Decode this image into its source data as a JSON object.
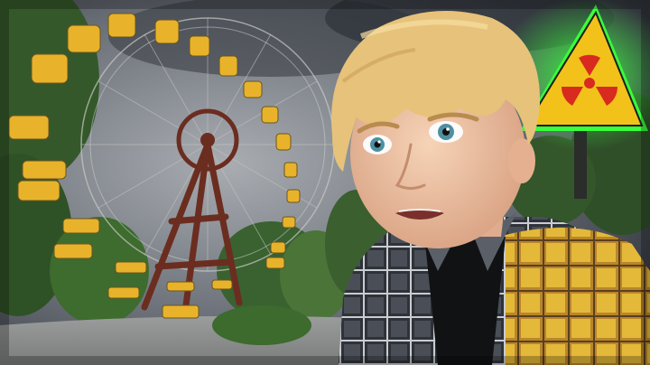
{
  "scene": {
    "kind": "video-thumbnail",
    "subjects": [
      "abandoned-ferris-wheel",
      "surprised-person",
      "radiation-warning-sign"
    ],
    "icons": [
      "radiation-icon"
    ]
  },
  "colors": {
    "sky_dark": "#2b2f36",
    "sky_mid": "#6f747c",
    "sky_light": "#a9adb2",
    "trees": "#3e6b2e",
    "gondola_yellow": "#e8b32a",
    "wheel_rust": "#6b2d20",
    "hair": "#e7c27a",
    "skin": "#f1c7a6",
    "shirt_yellow": "#e4b93a",
    "shirt_plaid": "#4a4f57",
    "sign_yellow": "#f2c21a",
    "sign_glow": "#39ff3d",
    "radiation_red": "#d92a1f"
  }
}
